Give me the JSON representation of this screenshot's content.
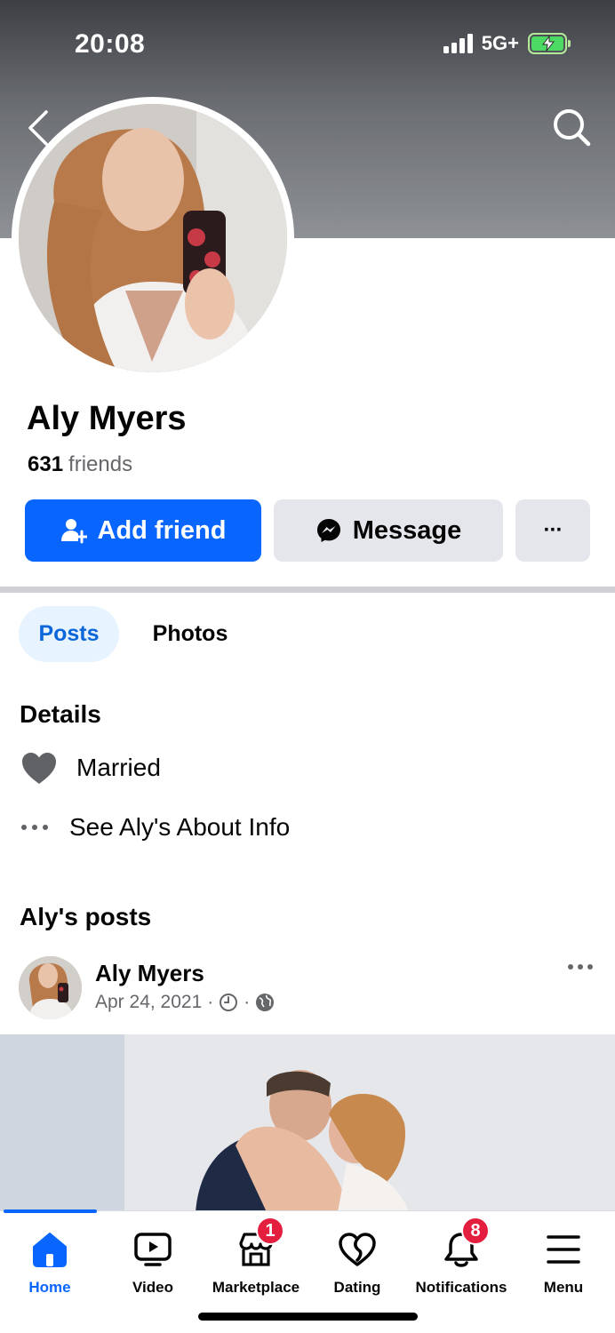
{
  "status_bar": {
    "time": "20:08",
    "network": "5G+"
  },
  "profile": {
    "name": "Aly Myers",
    "friends_count": "631",
    "friends_label": "friends"
  },
  "actions": {
    "add_friend": "Add friend",
    "message": "Message",
    "more": "···"
  },
  "tabs": [
    {
      "label": "Posts",
      "active": true
    },
    {
      "label": "Photos",
      "active": false
    }
  ],
  "details": {
    "title": "Details",
    "relationship": "Married",
    "about_link": "See Aly's About Info"
  },
  "posts": {
    "title": "Aly's posts",
    "first_post": {
      "author": "Aly Myers",
      "date": "Apr 24, 2021",
      "separator": "·"
    }
  },
  "bottom_nav": [
    {
      "label": "Home",
      "icon": "home-icon",
      "active": true
    },
    {
      "label": "Video",
      "icon": "video-icon",
      "active": false
    },
    {
      "label": "Marketplace",
      "icon": "marketplace-icon",
      "badge": "1"
    },
    {
      "label": "Dating",
      "icon": "dating-icon"
    },
    {
      "label": "Notifications",
      "icon": "bell-icon",
      "badge": "8"
    },
    {
      "label": "Menu",
      "icon": "menu-icon"
    }
  ],
  "colors": {
    "accent": "#0866ff",
    "badge": "#e41e3f",
    "secondary_text": "#65676b",
    "button_gray": "#e4e6eb"
  }
}
